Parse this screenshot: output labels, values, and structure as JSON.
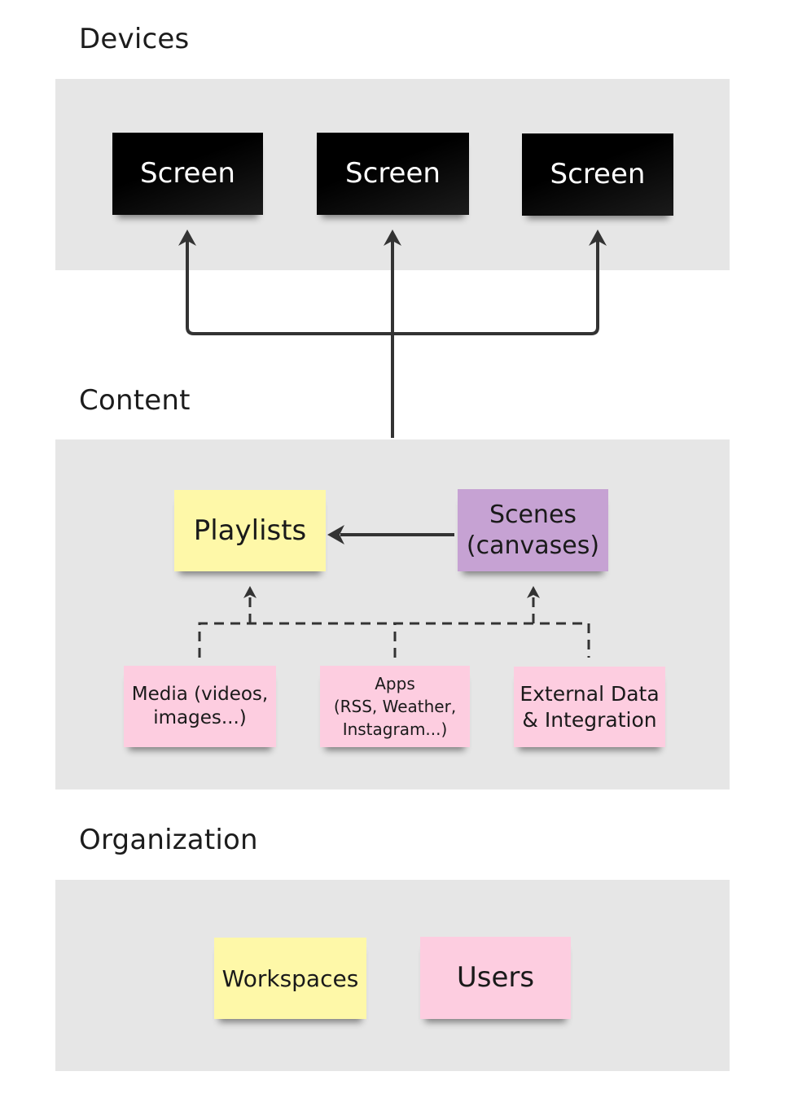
{
  "sections": {
    "devices": {
      "title": "Devices"
    },
    "content": {
      "title": "Content"
    },
    "organization": {
      "title": "Organization"
    }
  },
  "devices": {
    "screens": [
      {
        "label": "Screen"
      },
      {
        "label": "Screen"
      },
      {
        "label": "Screen"
      }
    ]
  },
  "content": {
    "playlists": {
      "label": "Playlists"
    },
    "scenes": {
      "line1": "Scenes",
      "line2": "(canvases)"
    },
    "sources": [
      {
        "line1": "Media (videos,",
        "line2": "images...)"
      },
      {
        "line1": "Apps",
        "line2": "(RSS, Weather,",
        "line3": "Instagram...)"
      },
      {
        "line1": "External Data",
        "line2": "& Integration"
      }
    ]
  },
  "organization": {
    "workspaces": {
      "label": "Workspaces"
    },
    "users": {
      "label": "Users"
    }
  },
  "colors": {
    "panel": "#e6e6e6",
    "screen": "#000000",
    "yellow_note": "#fef8a8",
    "purple_note": "#c6a2d3",
    "pink_note": "#fdcde0",
    "connector": "#333333"
  }
}
